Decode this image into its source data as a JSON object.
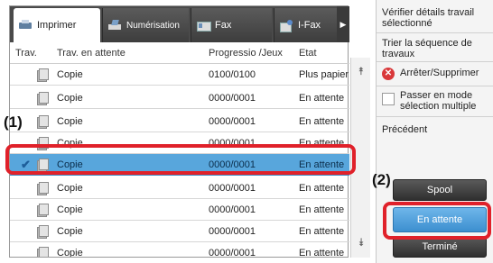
{
  "tabs": [
    {
      "label": "Imprimer",
      "icon": "printer-icon",
      "active": true
    },
    {
      "label": "Numérisation",
      "icon": "scanner-icon",
      "active": false
    },
    {
      "label": "Fax",
      "icon": "fax-icon",
      "active": false
    },
    {
      "label": "I-Fax",
      "icon": "internet-fax-icon",
      "active": false
    }
  ],
  "tab_scroll_glyph": "▶",
  "columns": {
    "trav": "Trav.",
    "waiting": "Trav. en attente",
    "progress": "Progressio /Jeux",
    "state": "Etat"
  },
  "rows": [
    {
      "name": "Copie",
      "progress": "0100/0100",
      "state": "Plus papier",
      "selected": false
    },
    {
      "name": "Copie",
      "progress": "0000/0001",
      "state": "En attente",
      "selected": false
    },
    {
      "name": "Copie",
      "progress": "0000/0001",
      "state": "En attente",
      "selected": false
    },
    {
      "name": "Copie",
      "progress": "0000/0001",
      "state": "En attente",
      "selected": false
    },
    {
      "name": "Copie",
      "progress": "0000/0001",
      "state": "En attente",
      "selected": true
    },
    {
      "name": "Copie",
      "progress": "0000/0001",
      "state": "En attente",
      "selected": false
    },
    {
      "name": "Copie",
      "progress": "0000/0001",
      "state": "En attente",
      "selected": false
    },
    {
      "name": "Copie",
      "progress": "0000/0001",
      "state": "En attente",
      "selected": false
    },
    {
      "name": "Copie",
      "progress": "0000/0001",
      "state": "En attente",
      "selected": false
    }
  ],
  "selected_check": "✔",
  "scroll": {
    "up": "⯭",
    "down": "⯯"
  },
  "side": {
    "verify": "Vérifier détails travail sélectionné",
    "sort": "Trier la séquence de travaux",
    "stop": "Arrêter/Supprimer",
    "stop_glyph": "✕",
    "multi": "Passer en mode sélection multiple",
    "previous": "Précédent",
    "spool": "Spool",
    "waiting": "En attente",
    "done": "Terminé"
  },
  "callouts": {
    "one": "(1)",
    "two": "(2)"
  },
  "colors": {
    "selected_row": "#58a6dc",
    "callout": "#e0212a",
    "active_button": "#4d9fdc"
  }
}
